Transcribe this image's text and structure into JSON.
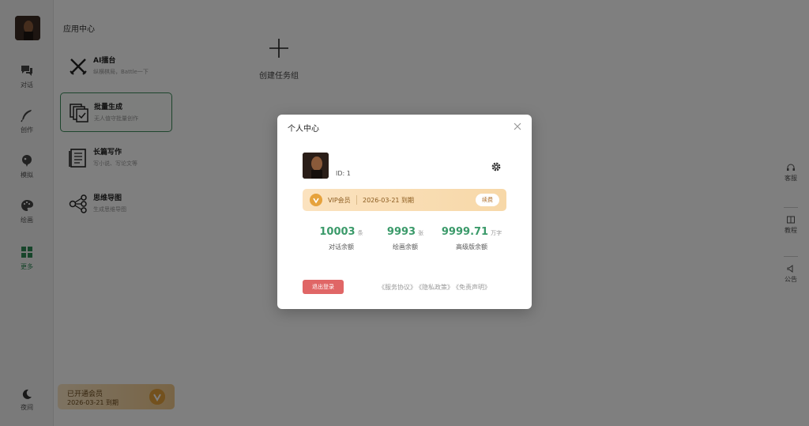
{
  "sidebar": {
    "items": [
      {
        "label": "对话",
        "icon": "chat-bubble-icon"
      },
      {
        "label": "创作",
        "icon": "feather-icon"
      },
      {
        "label": "模拟",
        "icon": "mask-icon"
      },
      {
        "label": "绘画",
        "icon": "palette-icon"
      },
      {
        "label": "更多",
        "icon": "grid-icon",
        "active": true
      }
    ],
    "night_label": "夜间",
    "night_icon": "moon-icon",
    "accent_color": "#2e8b57"
  },
  "main": {
    "section_title": "应用中心",
    "apps": [
      {
        "title": "AI擂台",
        "desc": "纵横棋局，Battle一下",
        "icon": "crossed-swords-icon"
      },
      {
        "title": "批量生成",
        "desc": "无人值守批量创作",
        "icon": "batch-copy-icon",
        "active": true
      },
      {
        "title": "长篇写作",
        "desc": "写小说、写论文等",
        "icon": "long-doc-icon"
      },
      {
        "title": "思维导图",
        "desc": "生成思维导图",
        "icon": "mindmap-icon"
      }
    ],
    "create_group_label": "创建任务组"
  },
  "member_banner": {
    "title": "已开通会员",
    "date": "2026-03-21 到期"
  },
  "right_tools": [
    {
      "label": "客服",
      "icon": "headset-icon"
    },
    {
      "label": "教程",
      "icon": "book-icon"
    },
    {
      "label": "公告",
      "icon": "announcement-icon"
    }
  ],
  "modal": {
    "title": "个人中心",
    "user_id": "ID: 1",
    "vip": {
      "label": "VIP会员",
      "expiry": "2026-03-21 到期",
      "renew_label": "续费",
      "color": "#8a5a1e"
    },
    "stats": [
      {
        "value": "10003",
        "unit": "条",
        "label": "对话余额"
      },
      {
        "value": "9993",
        "unit": "张",
        "label": "绘画余额"
      },
      {
        "value": "9999.71",
        "unit": "万字",
        "label": "高级版余额"
      }
    ],
    "stat_color": "#3b9a6a",
    "logout_label": "退出登录",
    "links": [
      "《服务协议》",
      "《隐私政策》",
      "《免责声明》"
    ]
  }
}
